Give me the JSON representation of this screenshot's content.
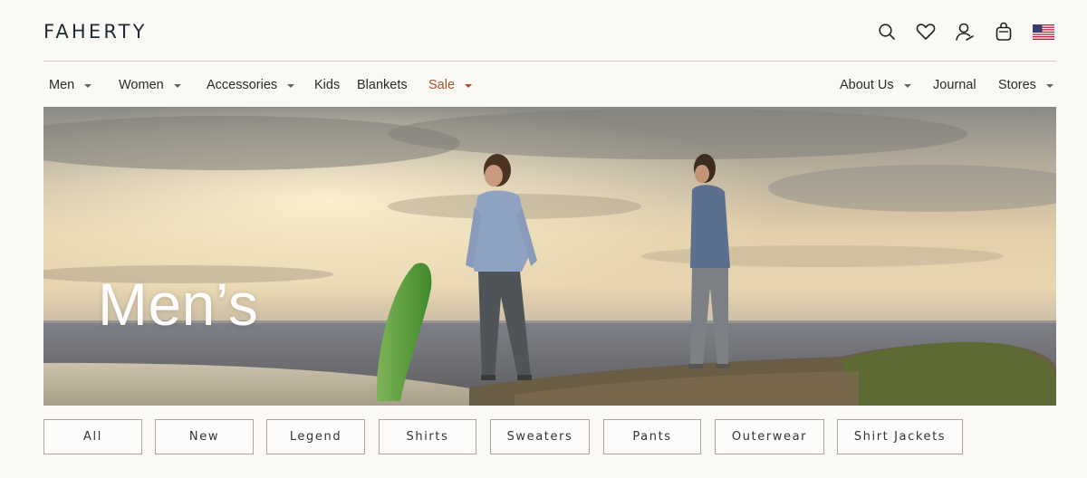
{
  "brand": {
    "logo_text": "FAHERTY"
  },
  "header_icons": [
    "search-icon",
    "heart-icon",
    "account-icon",
    "cart-icon",
    "us-flag-icon"
  ],
  "nav": {
    "left": [
      {
        "label": "Men",
        "dropdown": true
      },
      {
        "label": "Women",
        "dropdown": true
      },
      {
        "label": "Accessories",
        "dropdown": true
      },
      {
        "label": "Kids",
        "dropdown": false
      },
      {
        "label": "Blankets",
        "dropdown": false
      },
      {
        "label": "Sale",
        "dropdown": true,
        "color": "#a5522a"
      }
    ],
    "right": [
      {
        "label": "About Us",
        "dropdown": true
      },
      {
        "label": "Journal",
        "dropdown": false
      },
      {
        "label": "Stores",
        "dropdown": true
      }
    ]
  },
  "hero": {
    "title": "Men’s"
  },
  "filters": [
    "All",
    "New",
    "Legend",
    "Shirts",
    "Sweaters",
    "Pants",
    "Outerwear",
    "Shirt Jackets"
  ],
  "colors": {
    "accent_sale": "#a5522a",
    "background": "#fbf9f6",
    "logo": "#1f2a36"
  }
}
